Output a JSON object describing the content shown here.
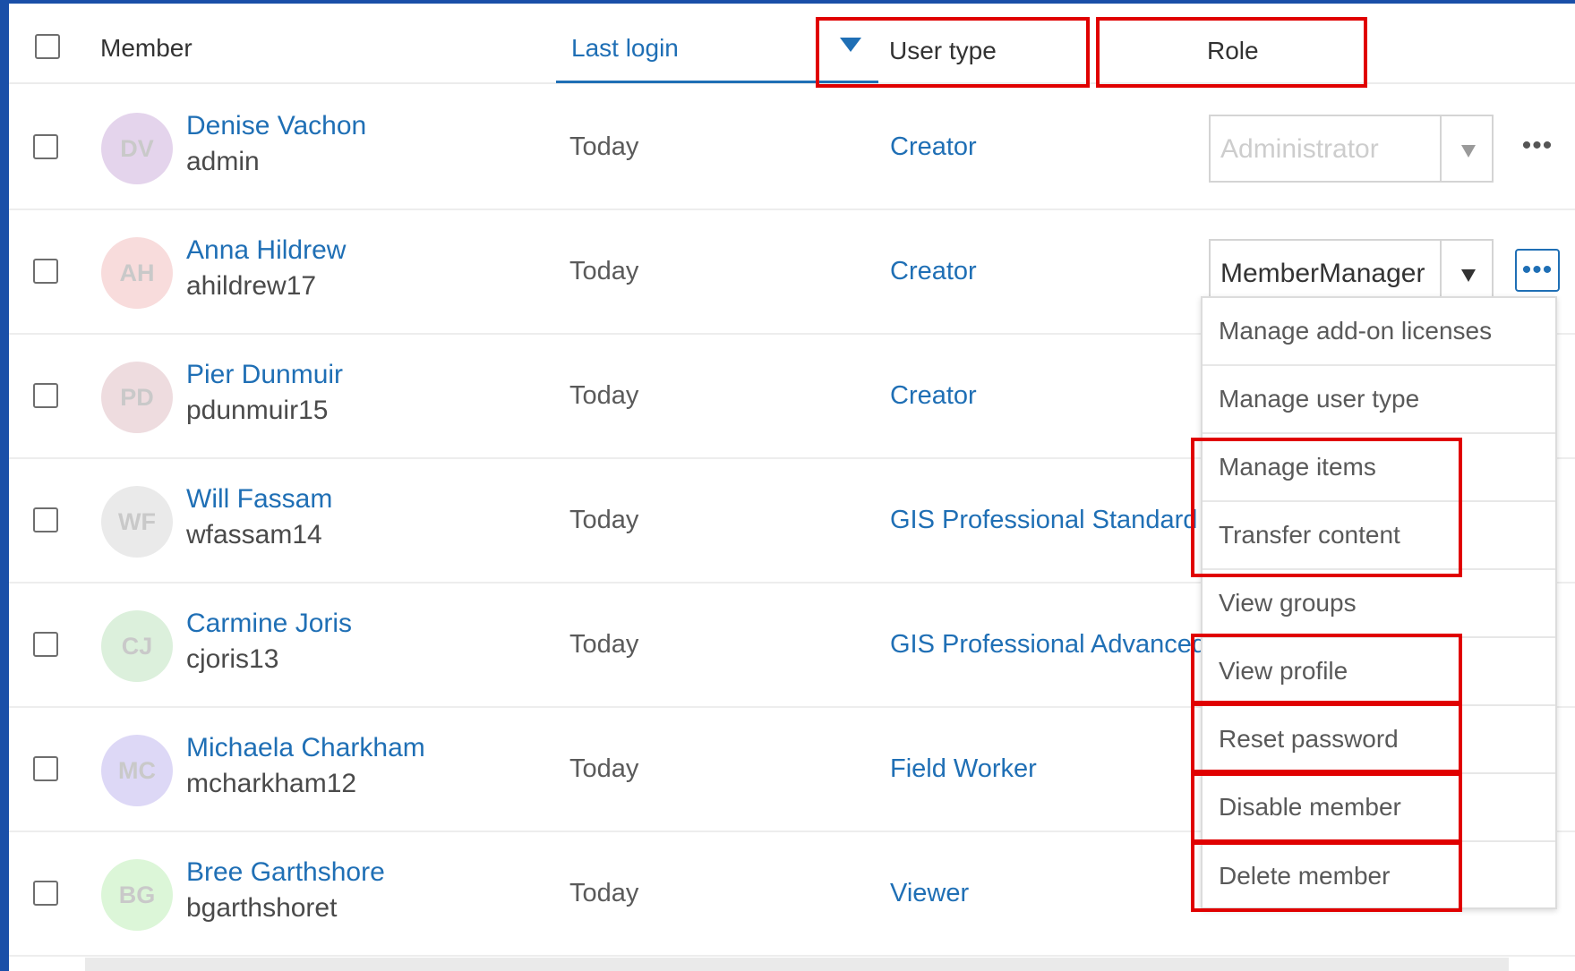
{
  "header": {
    "member": "Member",
    "last_login": "Last login",
    "user_type": "User type",
    "role": "Role"
  },
  "members": [
    {
      "initials": "DV",
      "name": "Denise Vachon",
      "username": "admin",
      "last_login": "Today",
      "user_type": "Creator",
      "role": "Administrator",
      "avatar_color": "#e4d4ec"
    },
    {
      "initials": "AH",
      "name": "Anna Hildrew",
      "username": "ahildrew17",
      "last_login": "Today",
      "user_type": "Creator",
      "role": "MemberManager",
      "avatar_color": "#f8dcdc"
    },
    {
      "initials": "PD",
      "name": "Pier Dunmuir",
      "username": "pdunmuir15",
      "last_login": "Today",
      "user_type": "Creator",
      "role": "",
      "avatar_color": "#eedcdf"
    },
    {
      "initials": "WF",
      "name": "Will Fassam",
      "username": "wfassam14",
      "last_login": "Today",
      "user_type": "GIS Professional Standard",
      "role": "",
      "avatar_color": "#eaeaea"
    },
    {
      "initials": "CJ",
      "name": "Carmine Joris",
      "username": "cjoris13",
      "last_login": "Today",
      "user_type": "GIS Professional Advanced",
      "role": "",
      "avatar_color": "#dcf0dc"
    },
    {
      "initials": "MC",
      "name": "Michaela Charkham",
      "username": "mcharkham12",
      "last_login": "Today",
      "user_type": "Field Worker",
      "role": "",
      "avatar_color": "#ddd8f6"
    },
    {
      "initials": "BG",
      "name": "Bree Garthshore",
      "username": "bgarthshoret",
      "last_login": "Today",
      "user_type": "Viewer",
      "role": "",
      "avatar_color": "#dcf6d8"
    }
  ],
  "more_label": "•••",
  "menu": {
    "items": [
      "Manage add-on licenses",
      "Manage user type",
      "Manage items",
      "Transfer content",
      "View groups",
      "View profile",
      "Reset password",
      "Disable member",
      "Delete member"
    ]
  },
  "colors": {
    "link": "#1f6fb5",
    "highlight": "#e00000",
    "outer_border": "#1a4fa8"
  }
}
